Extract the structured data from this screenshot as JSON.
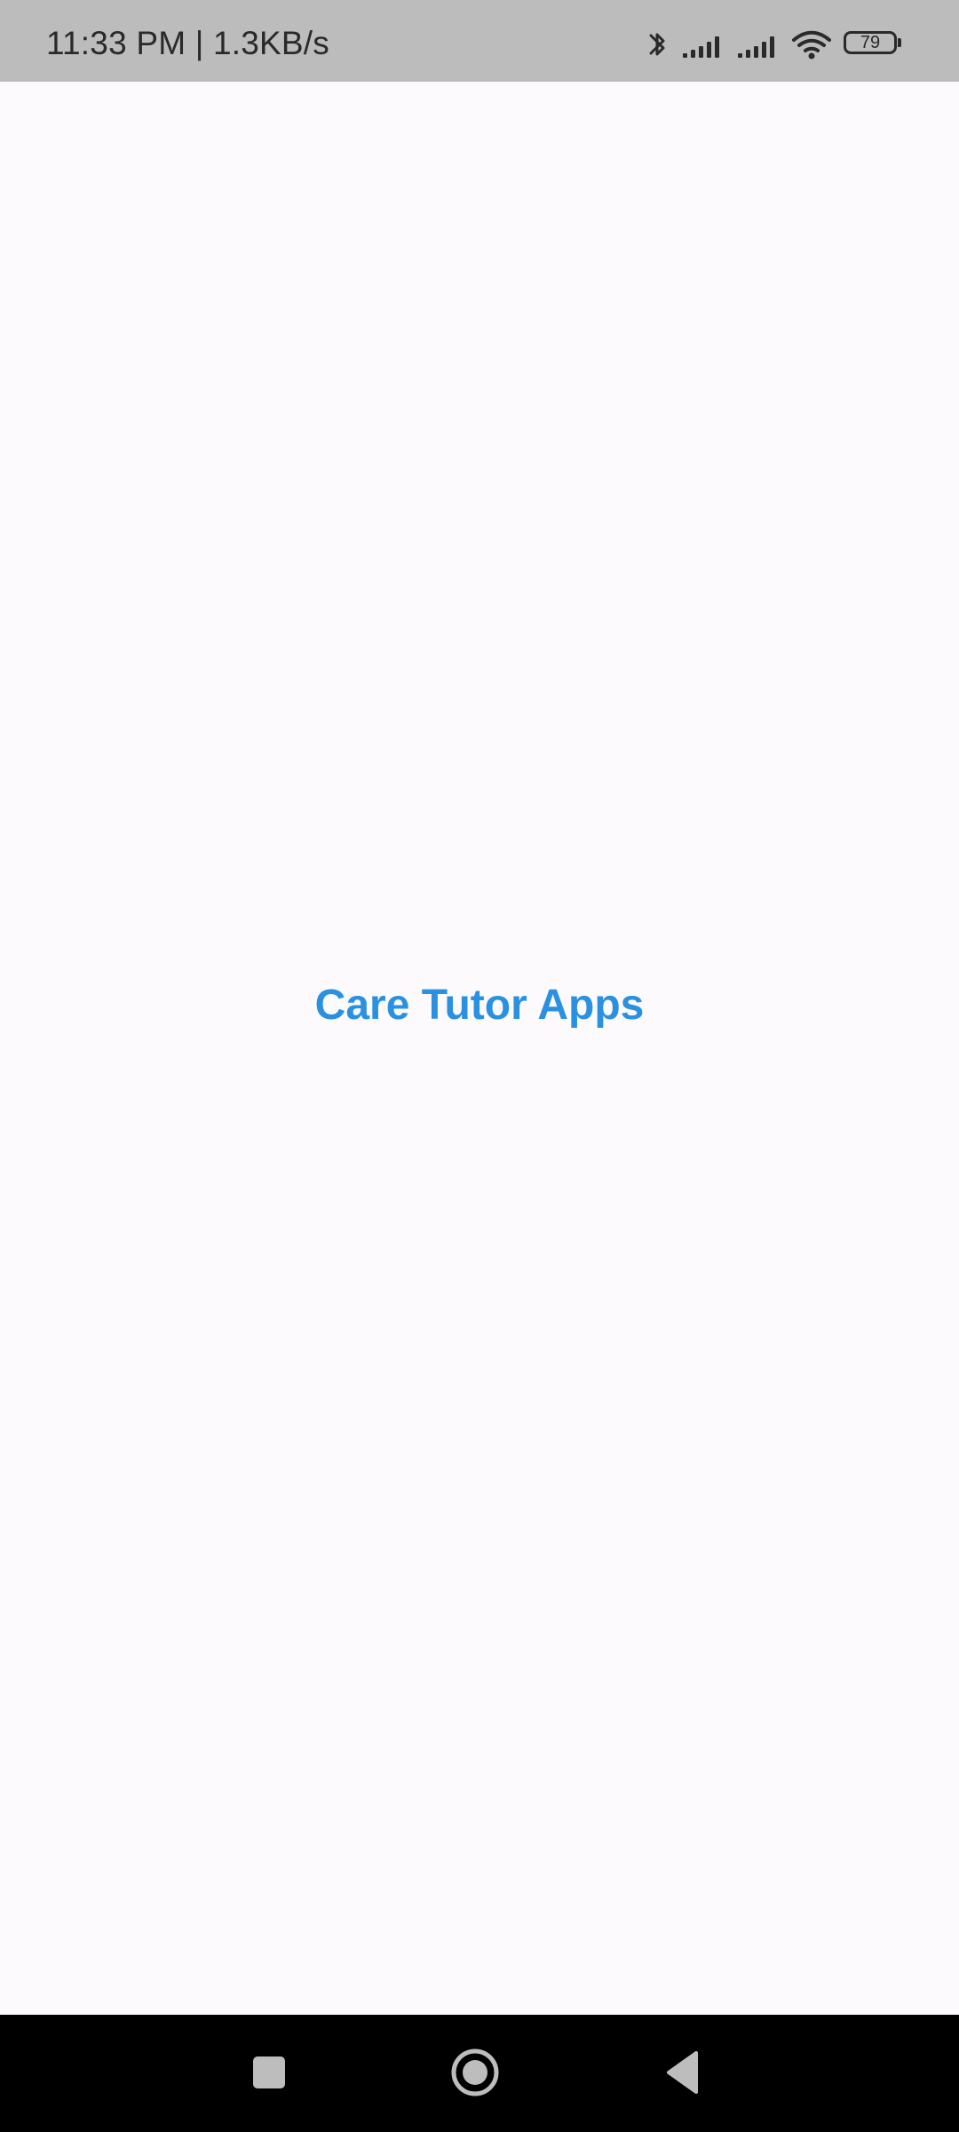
{
  "status_bar": {
    "time_and_speed": "11:33 PM | 1.3KB/s",
    "battery_level": "79",
    "icons": [
      "bluetooth-icon",
      "signal-icon",
      "signal-icon",
      "wifi-icon",
      "battery-icon"
    ]
  },
  "main": {
    "title": "Care Tutor Apps",
    "title_color": "#2a91e1",
    "background_color": "#fdfafd"
  },
  "navigation_bar": {
    "buttons": [
      "recent-apps-icon",
      "home-icon",
      "back-icon"
    ]
  }
}
